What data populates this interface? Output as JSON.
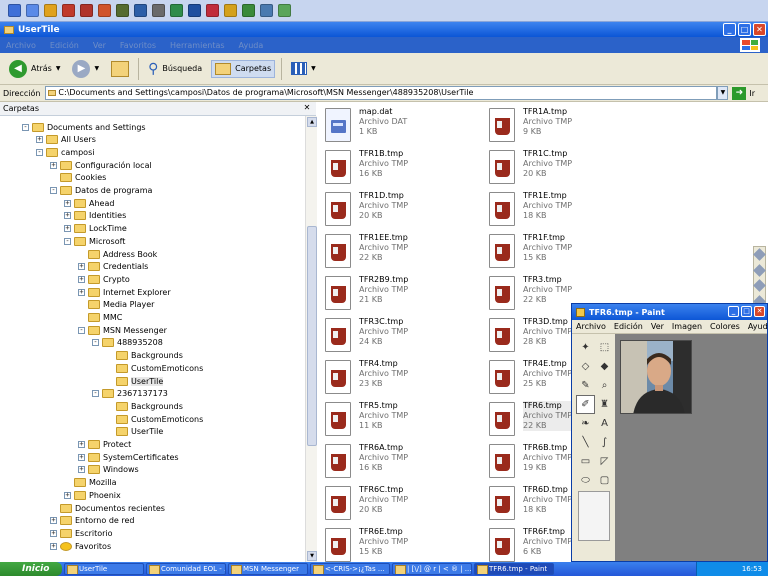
{
  "window": {
    "title": "UserTile"
  },
  "title_buttons": {
    "minimize": "_",
    "maximize": "□",
    "close": "✕"
  },
  "menu": {
    "items": [
      "Archivo",
      "Edición",
      "Ver",
      "Favoritos",
      "Herramientas",
      "Ayuda"
    ]
  },
  "toolbar": {
    "back": "Atrás",
    "search": "Búsqueda",
    "folders": "Carpetas"
  },
  "address": {
    "label": "Dirección",
    "path": "C:\\Documents and Settings\\camposi\\Datos de programa\\Microsoft\\MSN Messenger\\488935208\\UserTile",
    "go": "Ir"
  },
  "folders_panel": {
    "title": "Carpetas"
  },
  "tree": [
    {
      "label": "Documents and Settings",
      "level": 2,
      "exp": "-"
    },
    {
      "label": "All Users",
      "level": 3,
      "exp": "+"
    },
    {
      "label": "camposi",
      "level": 3,
      "exp": "-"
    },
    {
      "label": "Configuración local",
      "level": 4,
      "exp": "+"
    },
    {
      "label": "Cookies",
      "level": 4,
      "exp": ""
    },
    {
      "label": "Datos de programa",
      "level": 4,
      "exp": "-"
    },
    {
      "label": "Ahead",
      "level": 5,
      "exp": "+"
    },
    {
      "label": "Identities",
      "level": 5,
      "exp": "+"
    },
    {
      "label": "LockTime",
      "level": 5,
      "exp": "+"
    },
    {
      "label": "Microsoft",
      "level": 5,
      "exp": "-"
    },
    {
      "label": "Address Book",
      "level": 6,
      "exp": ""
    },
    {
      "label": "Credentials",
      "level": 6,
      "exp": "+"
    },
    {
      "label": "Crypto",
      "level": 6,
      "exp": "+"
    },
    {
      "label": "Internet Explorer",
      "level": 6,
      "exp": "+"
    },
    {
      "label": "Media Player",
      "level": 6,
      "exp": ""
    },
    {
      "label": "MMC",
      "level": 6,
      "exp": ""
    },
    {
      "label": "MSN Messenger",
      "level": 6,
      "exp": "-"
    },
    {
      "label": "488935208",
      "level": 7,
      "exp": "-"
    },
    {
      "label": "Backgrounds",
      "level": 8,
      "exp": ""
    },
    {
      "label": "CustomEmoticons",
      "level": 8,
      "exp": ""
    },
    {
      "label": "UserTile",
      "level": 8,
      "exp": "",
      "selected": true
    },
    {
      "label": "2367137173",
      "level": 7,
      "exp": "-"
    },
    {
      "label": "Backgrounds",
      "level": 8,
      "exp": ""
    },
    {
      "label": "CustomEmoticons",
      "level": 8,
      "exp": ""
    },
    {
      "label": "UserTile",
      "level": 8,
      "exp": ""
    },
    {
      "label": "Protect",
      "level": 6,
      "exp": "+"
    },
    {
      "label": "SystemCertificates",
      "level": 6,
      "exp": "+"
    },
    {
      "label": "Windows",
      "level": 6,
      "exp": "+"
    },
    {
      "label": "Mozilla",
      "level": 5,
      "exp": ""
    },
    {
      "label": "Phoenix",
      "level": 5,
      "exp": "+"
    },
    {
      "label": "Documentos recientes",
      "level": 4,
      "exp": ""
    },
    {
      "label": "Entorno de red",
      "level": 4,
      "exp": "+"
    },
    {
      "label": "Escritorio",
      "level": 4,
      "exp": "+"
    },
    {
      "label": "Favoritos",
      "level": 4,
      "exp": "+"
    }
  ],
  "files": [
    {
      "name": "map.dat",
      "type": "Archivo DAT",
      "size": "1 KB",
      "kind": "dat"
    },
    {
      "name": "TFR1A.tmp",
      "type": "Archivo TMP",
      "size": "9 KB",
      "kind": "tmp"
    },
    {
      "name": "TFR1B.tmp",
      "type": "Archivo TMP",
      "size": "16 KB",
      "kind": "tmp"
    },
    {
      "name": "TFR1C.tmp",
      "type": "Archivo TMP",
      "size": "20 KB",
      "kind": "tmp"
    },
    {
      "name": "TFR1D.tmp",
      "type": "Archivo TMP",
      "size": "20 KB",
      "kind": "tmp"
    },
    {
      "name": "TFR1E.tmp",
      "type": "Archivo TMP",
      "size": "18 KB",
      "kind": "tmp"
    },
    {
      "name": "TFR1EE.tmp",
      "type": "Archivo TMP",
      "size": "22 KB",
      "kind": "tmp"
    },
    {
      "name": "TFR1F.tmp",
      "type": "Archivo TMP",
      "size": "15 KB",
      "kind": "tmp"
    },
    {
      "name": "TFR2B9.tmp",
      "type": "Archivo TMP",
      "size": "21 KB",
      "kind": "tmp"
    },
    {
      "name": "TFR3.tmp",
      "type": "Archivo TMP",
      "size": "22 KB",
      "kind": "tmp"
    },
    {
      "name": "TFR3C.tmp",
      "type": "Archivo TMP",
      "size": "24 KB",
      "kind": "tmp"
    },
    {
      "name": "TFR3D.tmp",
      "type": "Archivo TMP",
      "size": "28 KB",
      "kind": "tmp"
    },
    {
      "name": "TFR4.tmp",
      "type": "Archivo TMP",
      "size": "23 KB",
      "kind": "tmp"
    },
    {
      "name": "TFR4E.tmp",
      "type": "Archivo TMP",
      "size": "25 KB",
      "kind": "tmp"
    },
    {
      "name": "TFR5.tmp",
      "type": "Archivo TMP",
      "size": "11 KB",
      "kind": "tmp"
    },
    {
      "name": "TFR6.tmp",
      "type": "Archivo TMP",
      "size": "22 KB",
      "kind": "tmp",
      "selected": true
    },
    {
      "name": "TFR6A.tmp",
      "type": "Archivo TMP",
      "size": "16 KB",
      "kind": "tmp"
    },
    {
      "name": "TFR6B.tmp",
      "type": "Archivo TMP",
      "size": "19 KB",
      "kind": "tmp"
    },
    {
      "name": "TFR6C.tmp",
      "type": "Archivo TMP",
      "size": "20 KB",
      "kind": "tmp"
    },
    {
      "name": "TFR6D.tmp",
      "type": "Archivo TMP",
      "size": "18 KB",
      "kind": "tmp"
    },
    {
      "name": "TFR6E.tmp",
      "type": "Archivo TMP",
      "size": "15 KB",
      "kind": "tmp"
    },
    {
      "name": "TFR6F.tmp",
      "type": "Archivo TMP",
      "size": "6 KB",
      "kind": "tmp"
    }
  ],
  "paint": {
    "title": "TFR6.tmp - Paint",
    "menu": [
      "Archivo",
      "Edición",
      "Ver",
      "Imagen",
      "Colores",
      "Ayuda"
    ],
    "tools": [
      "✦",
      "⬚",
      "◇",
      "◆",
      "✎",
      "⌕",
      "✐",
      "♜",
      "❧",
      "A",
      "╲",
      "∫",
      "▭",
      "◸",
      "⬭",
      "▢"
    ]
  },
  "taskbar": {
    "start": "Inicio",
    "tasks": [
      "UserTile",
      "Comunidad EOL - ...",
      "MSN Messenger",
      "<-CRIS->¡¿Tas ...",
      "| [\\/] @ r | < ® | ...",
      "TFR6.tmp - Paint"
    ],
    "clock": "16:53"
  },
  "colors": {
    "titlebar": "#0b55d6",
    "taskbar": "#2457d8",
    "start": "#2d8a2d",
    "tmp_icon": "#9a2a1c"
  }
}
